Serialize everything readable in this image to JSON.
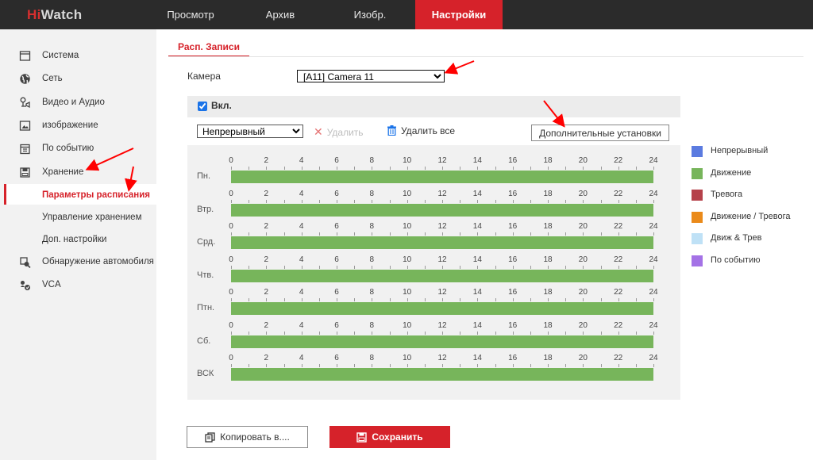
{
  "brand": {
    "hi": "Hi",
    "watch": "Watch"
  },
  "nav": {
    "tabs": [
      {
        "label": "Просмотр"
      },
      {
        "label": "Архив"
      },
      {
        "label": "Изобр."
      },
      {
        "label": "Настройки"
      }
    ]
  },
  "sidebar": {
    "items": [
      {
        "label": "Система",
        "icon": "monitor-icon"
      },
      {
        "label": "Сеть",
        "icon": "globe-icon"
      },
      {
        "label": "Видео и Аудио",
        "icon": "audio-video-icon"
      },
      {
        "label": "изображение",
        "icon": "image-icon"
      },
      {
        "label": "По событию",
        "icon": "calendar-icon"
      },
      {
        "label": "Хранение",
        "icon": "storage-icon"
      },
      {
        "label": "Обнаружение автомобиля",
        "icon": "vehicle-icon"
      },
      {
        "label": "VCA",
        "icon": "vca-icon"
      }
    ],
    "storage_sub": [
      {
        "label": "Параметры расписания"
      },
      {
        "label": "Управление хранением"
      },
      {
        "label": "Доп. настройки"
      }
    ]
  },
  "main": {
    "subtab": "Расп. Записи",
    "camera_label": "Камера",
    "camera_value": "[A11] Camera 11",
    "enable_label": "Вкл.",
    "mode_value": "Непрерывный",
    "delete_label": "Удалить",
    "delete_all_label": "Удалить все",
    "advanced_label": "Дополнительные установки",
    "hours": [
      "0",
      "2",
      "4",
      "6",
      "8",
      "10",
      "12",
      "14",
      "16",
      "18",
      "20",
      "22",
      "24"
    ],
    "days": [
      {
        "label": "Пн.",
        "start": 0,
        "end": 24,
        "type": "Движение"
      },
      {
        "label": "Втр.",
        "start": 0,
        "end": 24,
        "type": "Движение"
      },
      {
        "label": "Срд.",
        "start": 0,
        "end": 24,
        "type": "Движение"
      },
      {
        "label": "Чтв.",
        "start": 0,
        "end": 24,
        "type": "Движение"
      },
      {
        "label": "Птн.",
        "start": 0,
        "end": 24,
        "type": "Движение"
      },
      {
        "label": "Сб.",
        "start": 0,
        "end": 24,
        "type": "Движение"
      },
      {
        "label": "ВСК",
        "start": 0,
        "end": 24,
        "type": "Движение"
      }
    ],
    "legend": [
      {
        "label": "Непрерывный",
        "color": "#5b7be0"
      },
      {
        "label": "Движение",
        "color": "#77b55b"
      },
      {
        "label": "Тревога",
        "color": "#b5414a"
      },
      {
        "label": "Движение / Тревога",
        "color": "#ea8a1a"
      },
      {
        "label": "Движ & Трев",
        "color": "#bfe1f6"
      },
      {
        "label": "По событию",
        "color": "#a472e6"
      }
    ],
    "copy_label": "Копировать в....",
    "save_label": "Сохранить"
  },
  "colors": {
    "accent": "#d6222a",
    "topbar": "#2b2b2b"
  }
}
